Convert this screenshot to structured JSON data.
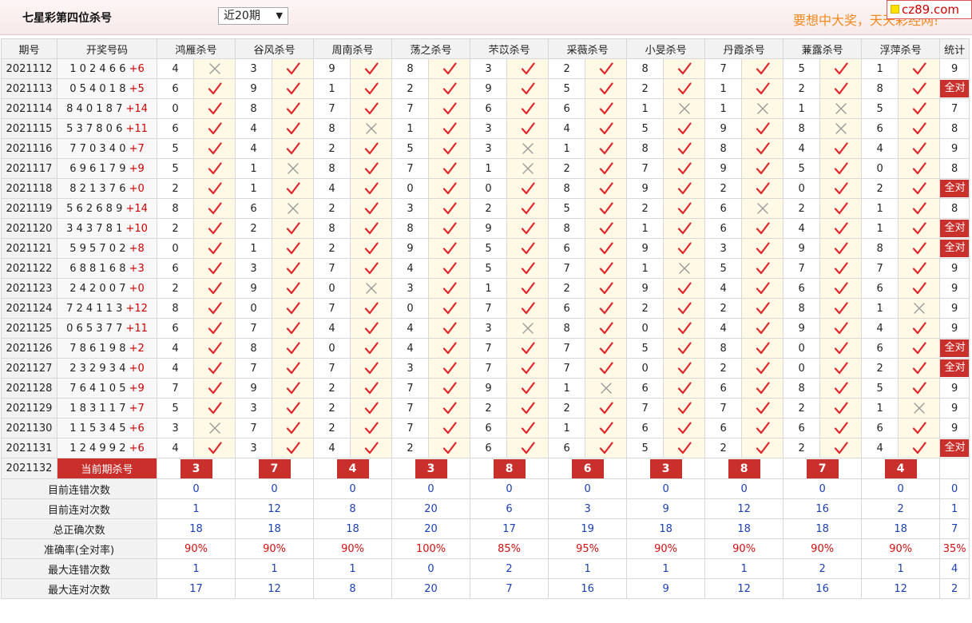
{
  "header": {
    "title": "七星彩第四位杀号",
    "period_select": "近20期",
    "slogan": "要想中大奖，天天彩经网!",
    "logo": "cz89.com"
  },
  "columns": {
    "issue": "期号",
    "draw": "开奖号码",
    "experts": [
      "鸿雁杀号",
      "谷风杀号",
      "周南杀号",
      "荡之杀号",
      "芣苡杀号",
      "采薇杀号",
      "小旻杀号",
      "丹霞杀号",
      "蒹露杀号",
      "浮萍杀号"
    ],
    "stat": "统计"
  },
  "all_right_label": "全对",
  "rows": [
    {
      "issue": "2021112",
      "digits": "1 0 2 4 6 6",
      "sum": "+6",
      "preds": [
        4,
        3,
        9,
        8,
        3,
        2,
        8,
        7,
        5,
        1
      ],
      "marks": "xvvvvvvvvv",
      "stat": "9"
    },
    {
      "issue": "2021113",
      "digits": "0 5 4 0 1 8",
      "sum": "+5",
      "preds": [
        6,
        9,
        1,
        2,
        9,
        5,
        2,
        1,
        2,
        8
      ],
      "marks": "vvvvvvvvvv",
      "stat": "全对"
    },
    {
      "issue": "2021114",
      "digits": "8 4 0 1 8 7",
      "sum": "+14",
      "preds": [
        0,
        8,
        7,
        7,
        6,
        6,
        1,
        1,
        1,
        5
      ],
      "marks": "vvvvvvxxxv",
      "stat": "7"
    },
    {
      "issue": "2021115",
      "digits": "5 3 7 8 0 6",
      "sum": "+11",
      "preds": [
        6,
        4,
        8,
        1,
        3,
        4,
        5,
        9,
        8,
        6
      ],
      "marks": "vvxvvvvvxv",
      "stat": "8"
    },
    {
      "issue": "2021116",
      "digits": "7 7 0 3 4 0",
      "sum": "+7",
      "preds": [
        5,
        4,
        2,
        5,
        3,
        1,
        8,
        8,
        4,
        4
      ],
      "marks": "vvvvxvvvvv",
      "stat": "9"
    },
    {
      "issue": "2021117",
      "digits": "6 9 6 1 7 9",
      "sum": "+9",
      "preds": [
        5,
        1,
        8,
        7,
        1,
        2,
        7,
        9,
        5,
        0
      ],
      "marks": "vxvvxvvvvv",
      "stat": "8"
    },
    {
      "issue": "2021118",
      "digits": "8 2 1 3 7 6",
      "sum": "+0",
      "preds": [
        2,
        1,
        4,
        0,
        0,
        8,
        9,
        2,
        0,
        2
      ],
      "marks": "vvvvvvvvvv",
      "stat": "全对"
    },
    {
      "issue": "2021119",
      "digits": "5 6 2 6 8 9",
      "sum": "+14",
      "preds": [
        8,
        6,
        2,
        3,
        2,
        5,
        2,
        6,
        2,
        1
      ],
      "marks": "vxvvvvvxvv",
      "stat": "8"
    },
    {
      "issue": "2021120",
      "digits": "3 4 3 7 8 1",
      "sum": "+10",
      "preds": [
        2,
        2,
        8,
        8,
        9,
        8,
        1,
        6,
        4,
        1
      ],
      "marks": "vvvvvvvvvv",
      "stat": "全对"
    },
    {
      "issue": "2021121",
      "digits": "5 9 5 7 0 2",
      "sum": "+8",
      "preds": [
        0,
        1,
        2,
        9,
        5,
        6,
        9,
        3,
        9,
        8
      ],
      "marks": "vvvvvvvvvv",
      "stat": "全对"
    },
    {
      "issue": "2021122",
      "digits": "6 8 8 1 6 8",
      "sum": "+3",
      "preds": [
        6,
        3,
        7,
        4,
        5,
        7,
        1,
        5,
        7,
        7
      ],
      "marks": "vvvvvvxvvv",
      "stat": "9"
    },
    {
      "issue": "2021123",
      "digits": "2 4 2 0 0 7",
      "sum": "+0",
      "preds": [
        2,
        9,
        0,
        3,
        1,
        2,
        9,
        4,
        6,
        6
      ],
      "marks": "vvxvvvvvvv",
      "stat": "9"
    },
    {
      "issue": "2021124",
      "digits": "7 2 4 1 1 3",
      "sum": "+12",
      "preds": [
        8,
        0,
        7,
        0,
        7,
        6,
        2,
        2,
        8,
        1
      ],
      "marks": "vvvvvvvvvx",
      "stat": "9"
    },
    {
      "issue": "2021125",
      "digits": "0 6 5 3 7 7",
      "sum": "+11",
      "preds": [
        6,
        7,
        4,
        4,
        3,
        8,
        0,
        4,
        9,
        4
      ],
      "marks": "vvvvxvvvvv",
      "stat": "9"
    },
    {
      "issue": "2021126",
      "digits": "7 8 6 1 9 8",
      "sum": "+2",
      "preds": [
        4,
        8,
        0,
        4,
        7,
        7,
        5,
        8,
        0,
        6
      ],
      "marks": "vvvvvvvvvv",
      "stat": "全对"
    },
    {
      "issue": "2021127",
      "digits": "2 3 2 9 3 4",
      "sum": "+0",
      "preds": [
        4,
        7,
        7,
        3,
        7,
        7,
        0,
        2,
        0,
        2
      ],
      "marks": "vvvvvvvvvv",
      "stat": "全对"
    },
    {
      "issue": "2021128",
      "digits": "7 6 4 1 0 5",
      "sum": "+9",
      "preds": [
        7,
        9,
        2,
        7,
        9,
        1,
        6,
        6,
        8,
        5
      ],
      "marks": "vvvvvxvvvv",
      "stat": "9"
    },
    {
      "issue": "2021129",
      "digits": "1 8 3 1 1 7",
      "sum": "+7",
      "preds": [
        5,
        3,
        2,
        7,
        2,
        2,
        7,
        7,
        2,
        1
      ],
      "marks": "vvvvvvvvvx",
      "stat": "9"
    },
    {
      "issue": "2021130",
      "digits": "1 1 5 3 4 5",
      "sum": "+6",
      "preds": [
        3,
        7,
        2,
        7,
        6,
        1,
        6,
        6,
        6,
        6
      ],
      "marks": "xvvvvvvvvv",
      "stat": "9"
    },
    {
      "issue": "2021131",
      "digits": "1 2 4 9 9 2",
      "sum": "+6",
      "preds": [
        4,
        3,
        4,
        2,
        6,
        6,
        5,
        2,
        2,
        4
      ],
      "marks": "vvvvvvvvvv",
      "stat": "全对"
    }
  ],
  "current": {
    "issue": "2021132",
    "label": "当前期杀号",
    "preds": [
      3,
      7,
      4,
      3,
      8,
      6,
      3,
      8,
      7,
      4
    ]
  },
  "summary": [
    {
      "label": "目前连错次数",
      "values": [
        "0",
        "0",
        "0",
        "0",
        "0",
        "0",
        "0",
        "0",
        "0",
        "0"
      ],
      "stat": "0",
      "red": false
    },
    {
      "label": "目前连对次数",
      "values": [
        "1",
        "12",
        "8",
        "20",
        "6",
        "3",
        "9",
        "12",
        "16",
        "2"
      ],
      "stat": "1",
      "red": false
    },
    {
      "label": "总正确次数",
      "values": [
        "18",
        "18",
        "18",
        "20",
        "17",
        "19",
        "18",
        "18",
        "18",
        "18"
      ],
      "stat": "7",
      "red": false
    },
    {
      "label": "准确率(全对率)",
      "values": [
        "90%",
        "90%",
        "90%",
        "100%",
        "85%",
        "95%",
        "90%",
        "90%",
        "90%",
        "90%"
      ],
      "stat": "35%",
      "red": true
    },
    {
      "label": "最大连错次数",
      "values": [
        "1",
        "1",
        "1",
        "0",
        "2",
        "1",
        "1",
        "1",
        "2",
        "1"
      ],
      "stat": "4",
      "red": false
    },
    {
      "label": "最大连对次数",
      "values": [
        "17",
        "12",
        "8",
        "20",
        "7",
        "16",
        "9",
        "12",
        "16",
        "12"
      ],
      "stat": "2",
      "red": false
    }
  ]
}
